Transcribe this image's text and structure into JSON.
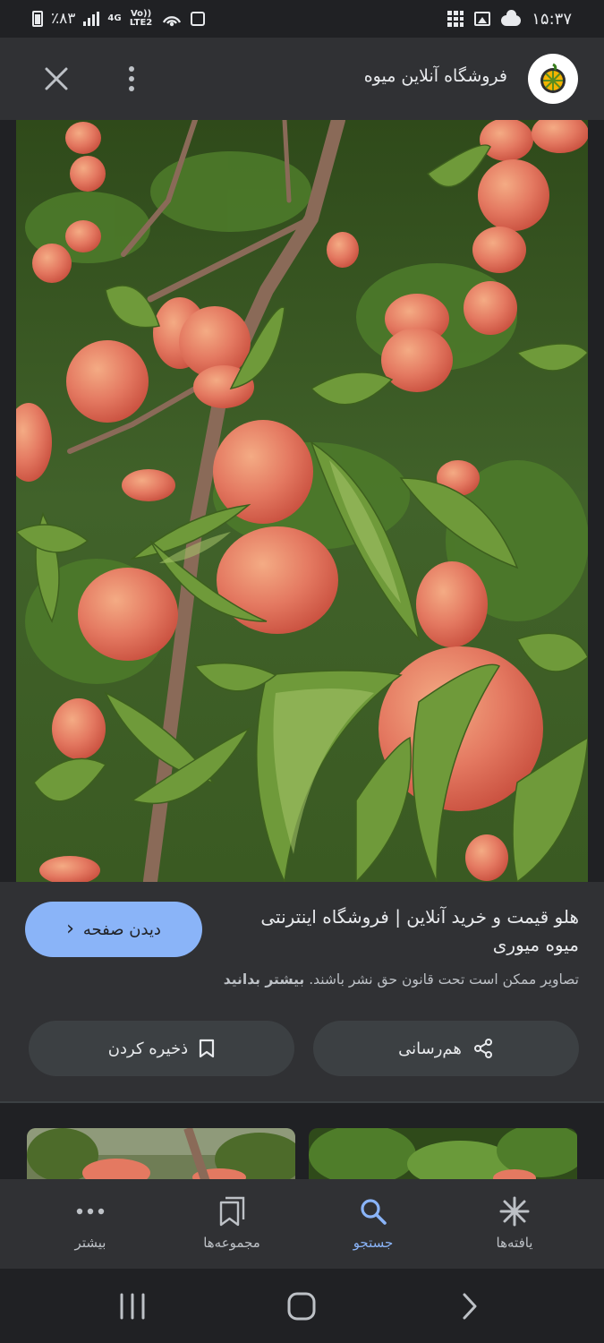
{
  "status_bar": {
    "battery": "٪۸۳",
    "network_label": "4G",
    "volte_label": "Vo)) LTE2",
    "time": "۱۵:۳۷"
  },
  "header": {
    "site_title": "فروشگاه آنلاین میوه"
  },
  "main_image": {
    "subject": "peaches on tree",
    "colors": {
      "leaf_dark": "#2f4a1a",
      "leaf": "#5c8a2e",
      "leaf_light": "#8fb850",
      "peach": "#e0725c",
      "peach_light": "#f1a27e",
      "branch": "#8a6a58"
    }
  },
  "result": {
    "title": "هلو قیمت و خرید آنلاین | فروشگاه اینترنتی میوه میوری",
    "copyright": "تصاویر ممکن است تحت قانون حق نشر باشند.",
    "learn_more": "بیشتر بدانید",
    "visit_label": "دیدن صفحه"
  },
  "actions": {
    "share_label": "هم‌رسانی",
    "save_label": "ذخیره کردن"
  },
  "bottom_nav": {
    "discover": "یافته‌ها",
    "search": "جستجو",
    "collections": "مجموعه‌ها",
    "more": "بیشتر",
    "active": "search"
  },
  "theme": {
    "accent": "#8ab4f8",
    "background": "#202124",
    "surface": "#303134",
    "chip": "#3c4043"
  }
}
